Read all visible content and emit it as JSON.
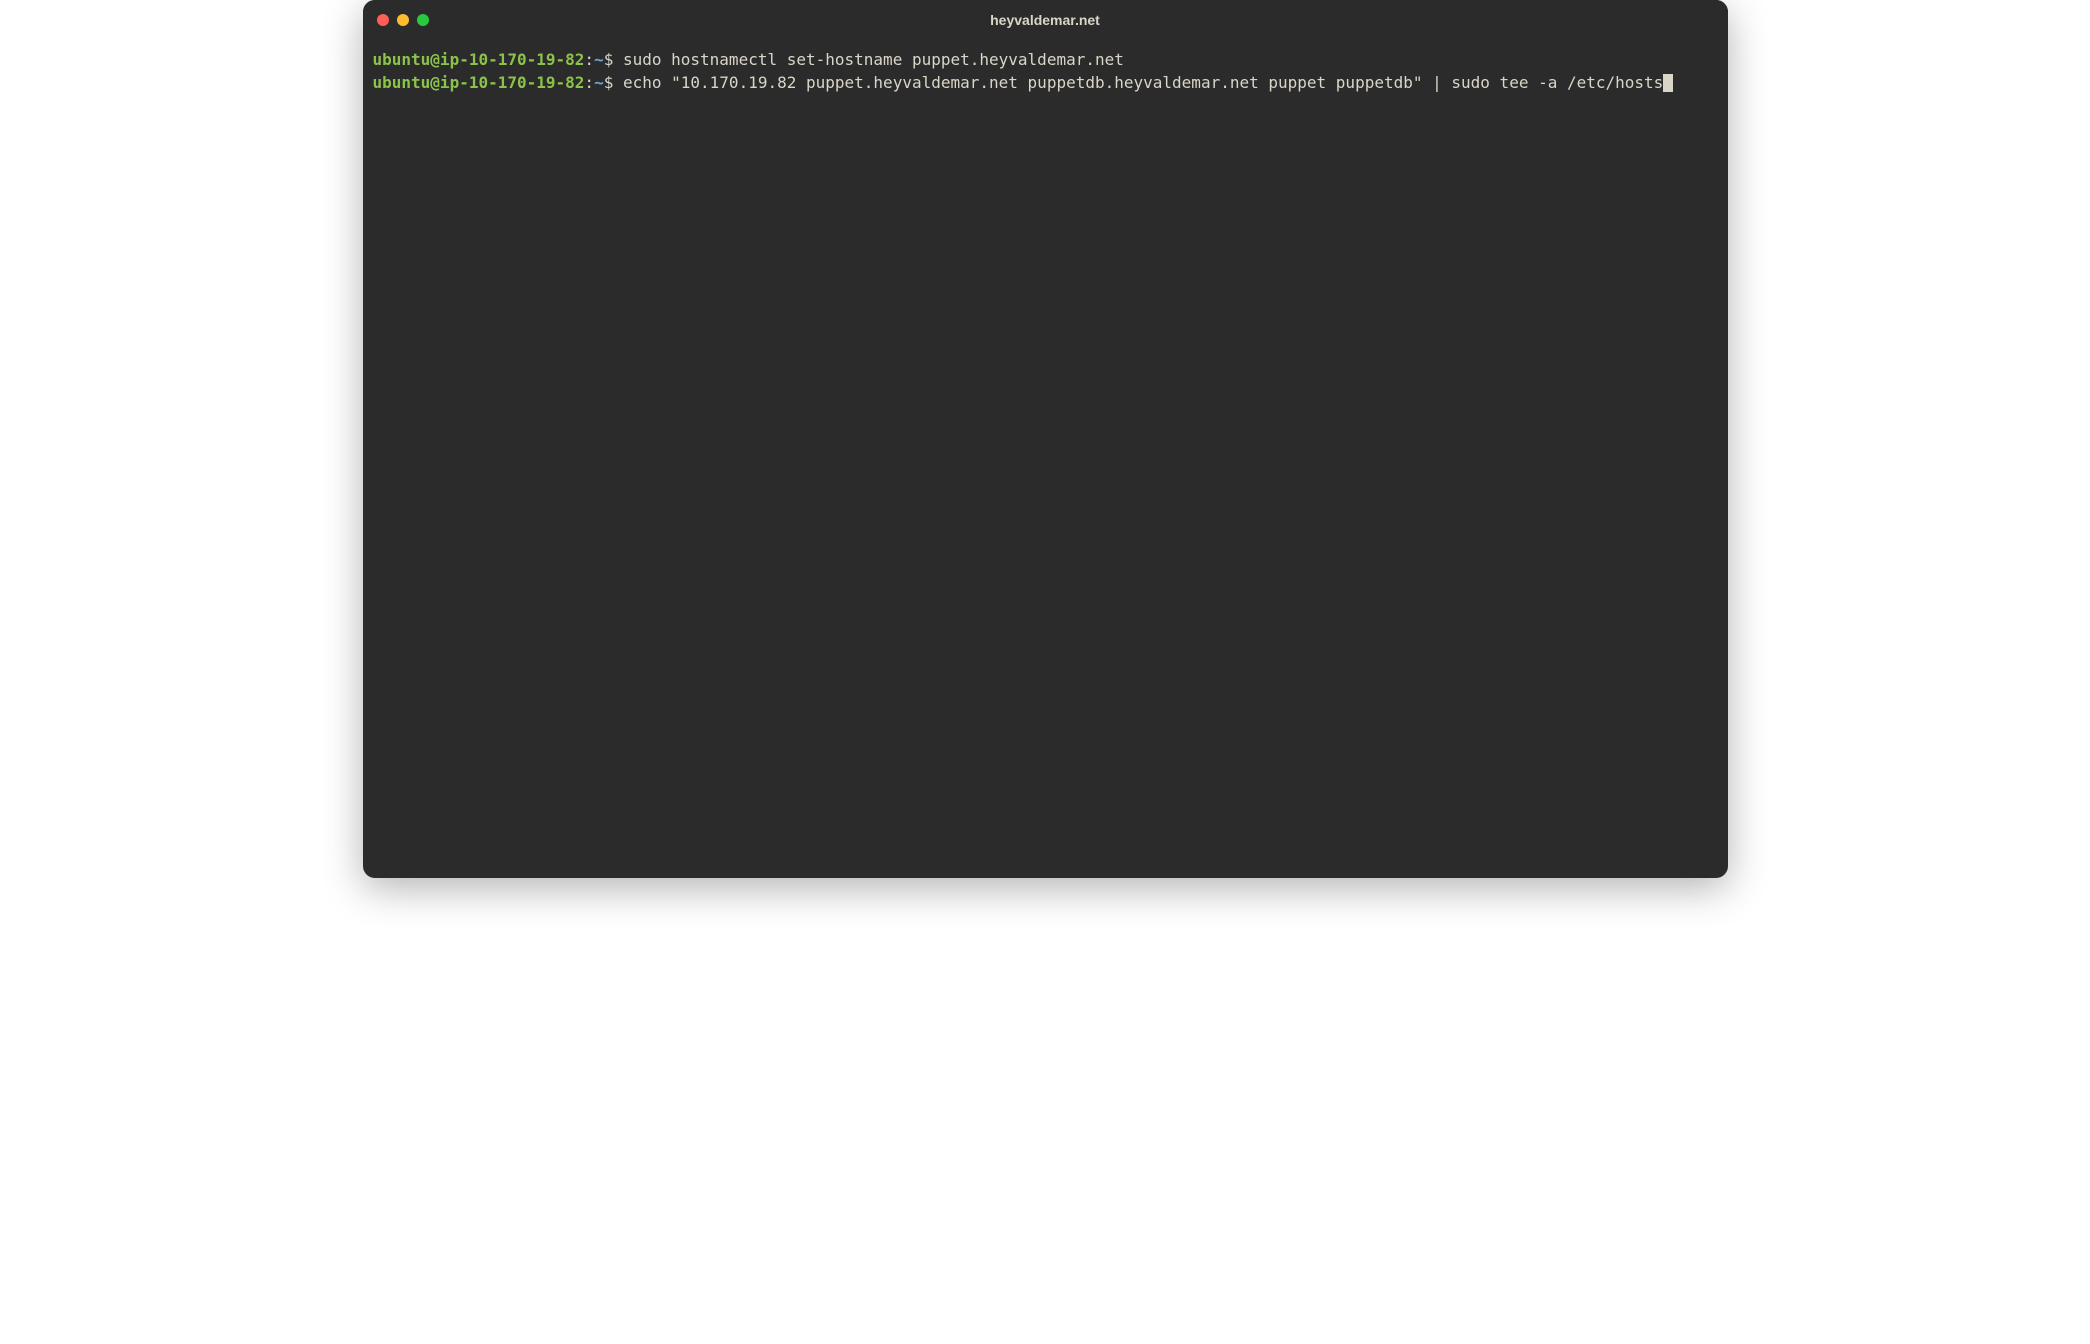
{
  "window": {
    "title": "heyvaldemar.net"
  },
  "traffic_lights": {
    "close": "close-icon",
    "minimize": "minimize-icon",
    "maximize": "maximize-icon"
  },
  "colors": {
    "bg": "#2b2b2b",
    "fg": "#d9d6c8",
    "prompt_user": "#8bc34a",
    "prompt_path": "#6aa7d8",
    "tl_close": "#ff5f57",
    "tl_min": "#febc2e",
    "tl_max": "#28c840"
  },
  "prompt_template": {
    "user_host": "ubuntu@ip-10-170-19-82",
    "colon": ":",
    "path": "~",
    "symbol": "$ "
  },
  "lines": [
    {
      "user_host": "ubuntu@ip-10-170-19-82",
      "colon": ":",
      "path": "~",
      "symbol": "$ ",
      "command": "sudo hostnamectl set-hostname puppet.heyvaldemar.net"
    },
    {
      "user_host": "ubuntu@ip-10-170-19-82",
      "colon": ":",
      "path": "~",
      "symbol": "$ ",
      "command": "echo \"10.170.19.82 puppet.heyvaldemar.net puppetdb.heyvaldemar.net puppet puppetdb\" | sudo tee -a /etc/hosts"
    }
  ],
  "cursor_after_last": true
}
